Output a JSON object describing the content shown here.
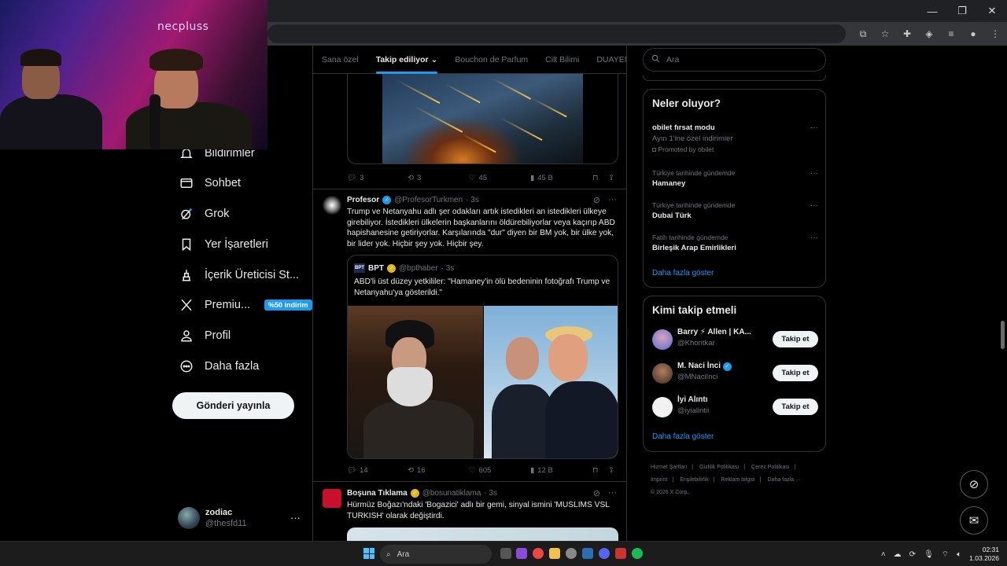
{
  "browser": {
    "window_controls": [
      "—",
      "❐",
      "✕"
    ]
  },
  "webcam": {
    "logo": "necpluss"
  },
  "nav": {
    "items": [
      {
        "label": "Bildirimler",
        "icon": "bell-icon"
      },
      {
        "label": "Sohbet",
        "icon": "mail-icon"
      },
      {
        "label": "Grok",
        "icon": "grok-icon"
      },
      {
        "label": "Yer İşaretleri",
        "icon": "bookmark-icon"
      },
      {
        "label": "İçerik Üreticisi St...",
        "icon": "creator-icon"
      },
      {
        "label": "Premiu...",
        "icon": "x-logo-icon",
        "badge": "%50 indirim"
      },
      {
        "label": "Profil",
        "icon": "person-icon"
      },
      {
        "label": "Daha fazla",
        "icon": "more-circle-icon"
      }
    ],
    "post_button": "Gönderi yayınla",
    "account": {
      "name": "zodiac",
      "handle": "@thesfd11",
      "more": "···"
    }
  },
  "timeline": {
    "tabs": [
      "Sana özel",
      "Takip ediliyor",
      "Bouchon de Parfum",
      "Cilt Bilimi",
      "DUAYEN"
    ],
    "active_tab": "Takip ediliyor",
    "top_actions": {
      "replies": "3",
      "reposts": "3",
      "likes": "45",
      "views": "45 B"
    },
    "tweet1": {
      "name": "Profesor",
      "handle": "@ProfesorTurkmen",
      "time": "· 3s",
      "text": "Trump ve Netanyahu adlı şer odakları artık istedikleri an istedikleri ülkeye girebiliyor. İstedikleri ülkelerin başkanlarını öldürebiliyorlar veya kaçırıp ABD hapishanesine getiriyorlar. Karşılarında \"dur\" diyen bir BM yok, bir ülke yok, bir lider yok. Hiçbir şey yok. Hiçbir şey.",
      "quote": {
        "logo": "BPT",
        "name": "BPT",
        "handle": "@bpthaber",
        "time": "· 3s",
        "text": "ABD'li üst düzey yetkililer: \"Hamaney'in ölü bedeninin fotoğrafı Trump ve Netanyahu'ya gösterildi.\""
      },
      "actions": {
        "replies": "14",
        "reposts": "16",
        "likes": "605",
        "views": "12 B"
      }
    },
    "tweet2": {
      "name": "Boşuna Tıklama",
      "handle": "@bosunatiklama",
      "time": "· 3s",
      "text": "Hürmüz Boğazı'ndaki 'Bogazici' adlı bir gemi, sinyal ismini 'MUSLIMS VSL TURKISH' olarak değiştirdi."
    }
  },
  "right": {
    "search_placeholder": "Ara",
    "trends": {
      "title": "Neler oluyor?",
      "items": [
        {
          "meta": "",
          "title": "obilet fırsat modu",
          "sub": "Ayın 1'ine özel indirimler",
          "promo": "Promoted by obilet"
        },
        {
          "meta": "Türkiye tarihinde gündemde",
          "title": "Hamaney"
        },
        {
          "meta": "Türkiye tarihinde gündemde",
          "title": "Dubai Türk"
        },
        {
          "meta": "Fatih tarihinde gündemde",
          "title": "Birleşik Arap Emirlikleri"
        }
      ],
      "show_more": "Daha fazla göster"
    },
    "who_to_follow": {
      "title": "Kimi takip etmeli",
      "users": [
        {
          "name": "Barry ⚡ Allen | KA...",
          "handle": "@Khontkar",
          "button": "Takip et"
        },
        {
          "name": "M. Naci İnci",
          "handle": "@MNaciInci",
          "button": "Takip et"
        },
        {
          "name": "İyi Alıntı",
          "handle": "@iyialintii",
          "button": "Takip et"
        }
      ],
      "show_more": "Daha fazla göster"
    },
    "footer": [
      "Hizmet Şartları",
      "|",
      "Gizlilik Politikası",
      "|",
      "Çerez Politikası",
      "|",
      "İmprint",
      "|",
      "Erişilebilirlik",
      "|",
      "Reklam bilgisi",
      "|",
      "Daha fazla ···",
      "© 2026 X Corp."
    ]
  },
  "taskbar": {
    "search": "Ara",
    "time": "02:31",
    "date": "1.03.2026"
  }
}
